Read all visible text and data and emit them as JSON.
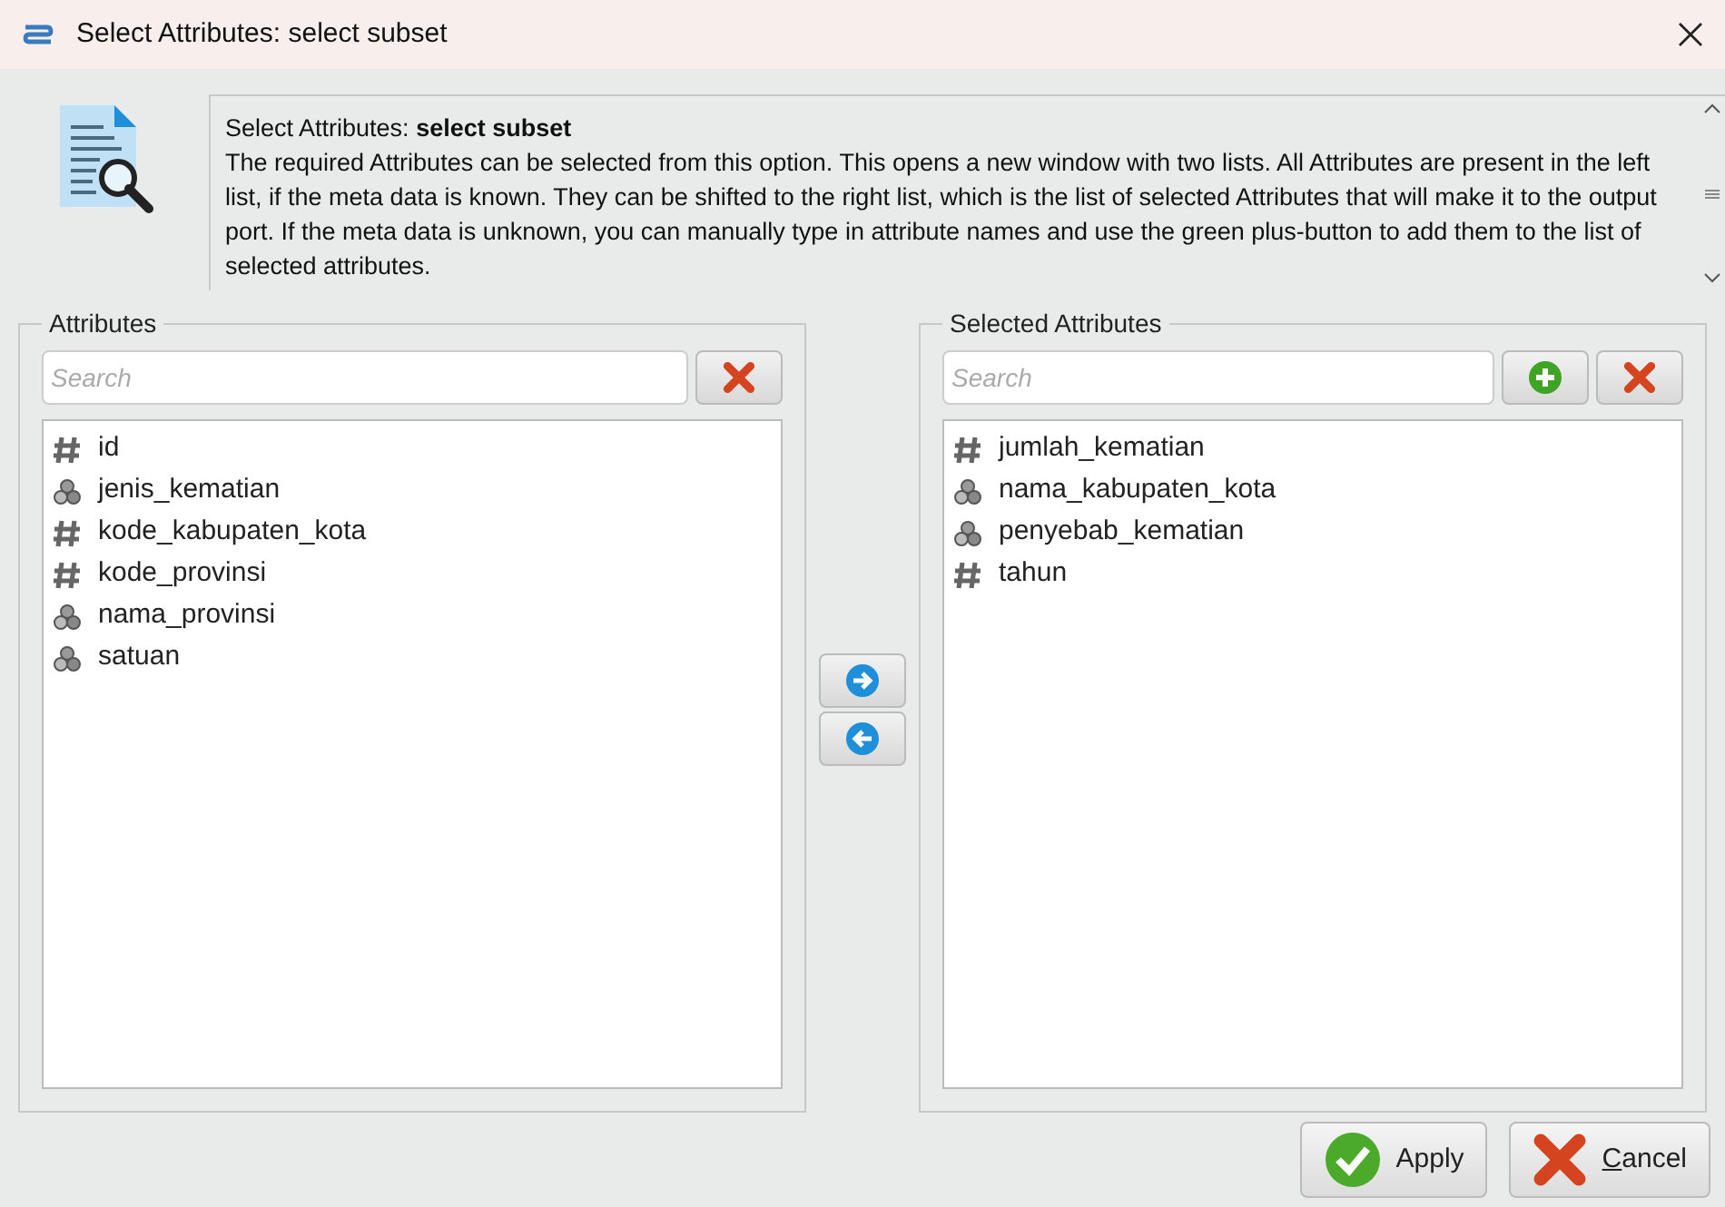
{
  "window": {
    "title": "Select Attributes: select subset"
  },
  "description": {
    "heading_prefix": "Select Attributes: ",
    "heading_bold": "select subset",
    "text": "The required Attributes can be selected from this option. This opens a new window with two lists. All Attributes are present in the left list, if the meta data is known. They can be shifted to the right list, which is the list of selected Attributes that will make it to the output port. If the meta data is unknown, you can manually type in attribute names and use the green plus-button to add them to the list of selected attributes."
  },
  "attributes": {
    "title": "Attributes",
    "search": {
      "placeholder": "Search"
    },
    "items": [
      {
        "name": "id",
        "kind": "numeric"
      },
      {
        "name": "jenis_kematian",
        "kind": "nominal"
      },
      {
        "name": "kode_kabupaten_kota",
        "kind": "numeric"
      },
      {
        "name": "kode_provinsi",
        "kind": "numeric"
      },
      {
        "name": "nama_provinsi",
        "kind": "nominal"
      },
      {
        "name": "satuan",
        "kind": "nominal"
      }
    ]
  },
  "selected_attributes": {
    "title": "Selected Attributes",
    "search": {
      "placeholder": "Search"
    },
    "items": [
      {
        "name": "jumlah_kematian",
        "kind": "numeric"
      },
      {
        "name": "nama_kabupaten_kota",
        "kind": "nominal"
      },
      {
        "name": "penyebab_kematian",
        "kind": "nominal"
      },
      {
        "name": "tahun",
        "kind": "numeric"
      }
    ]
  },
  "buttons": [
    {
      "label": "Apply",
      "kind": "apply",
      "first_letter_underlined": false
    },
    {
      "label": "Cancel",
      "kind": "cancel",
      "first_letter_underlined": true
    }
  ]
}
